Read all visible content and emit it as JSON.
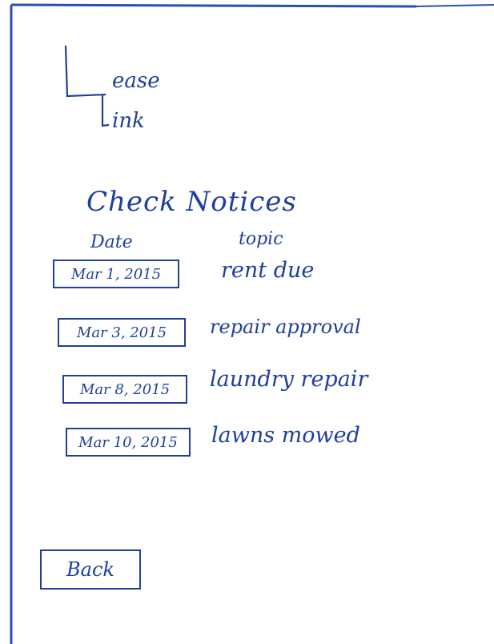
{
  "logo": {
    "line1": "ease",
    "line2": "ink"
  },
  "title": "Check Notices",
  "columns": {
    "date": "Date",
    "topic": "topic"
  },
  "notices": [
    {
      "date": "Mar 1, 2015",
      "topic": "rent due"
    },
    {
      "date": "Mar 3, 2015",
      "topic": "repair approval"
    },
    {
      "date": "Mar 8, 2015",
      "topic": "laundry repair"
    },
    {
      "date": "Mar 10, 2015",
      "topic": "lawns mowed"
    }
  ],
  "back_label": "Back",
  "colors": {
    "ink": "#1f3f9e",
    "frame": "#2b4fb0",
    "background": "#ffffff"
  }
}
